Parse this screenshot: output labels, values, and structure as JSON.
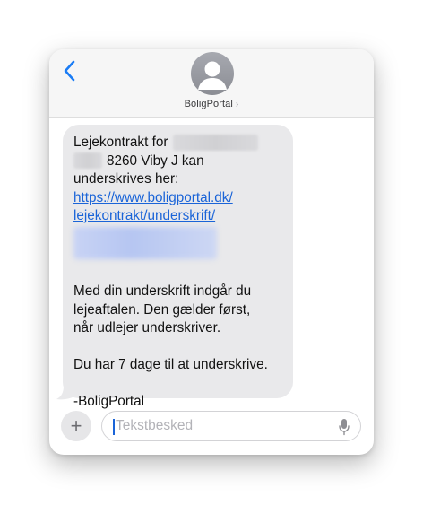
{
  "header": {
    "contact_name": "BoligPortal",
    "chevron": "›",
    "back_icon": "chevron-left-icon",
    "avatar_icon": "person-silhouette-icon"
  },
  "message": {
    "line1": "Lejekontrakt for",
    "line2": "8260 Viby J kan",
    "line3": "underskrives her:",
    "link_line1": "https://www.boligportal.dk/",
    "link_line2": "lejekontrakt/underskrift/",
    "para2_line1": "Med din underskrift indgår du",
    "para2_line2": "lejeaftalen. Den gælder først,",
    "para2_line3": "når udlejer underskriver.",
    "para3_line1": "Du har 7 dage til at underskrive.",
    "signature": "-BoligPortal"
  },
  "composer": {
    "plus_label": "+",
    "placeholder": "Tekstbesked",
    "value": "",
    "mic_icon": "microphone-icon"
  },
  "colors": {
    "accent": "#1a64d8",
    "bubble": "#e9e9eb",
    "header_bg": "#f6f6f6"
  }
}
